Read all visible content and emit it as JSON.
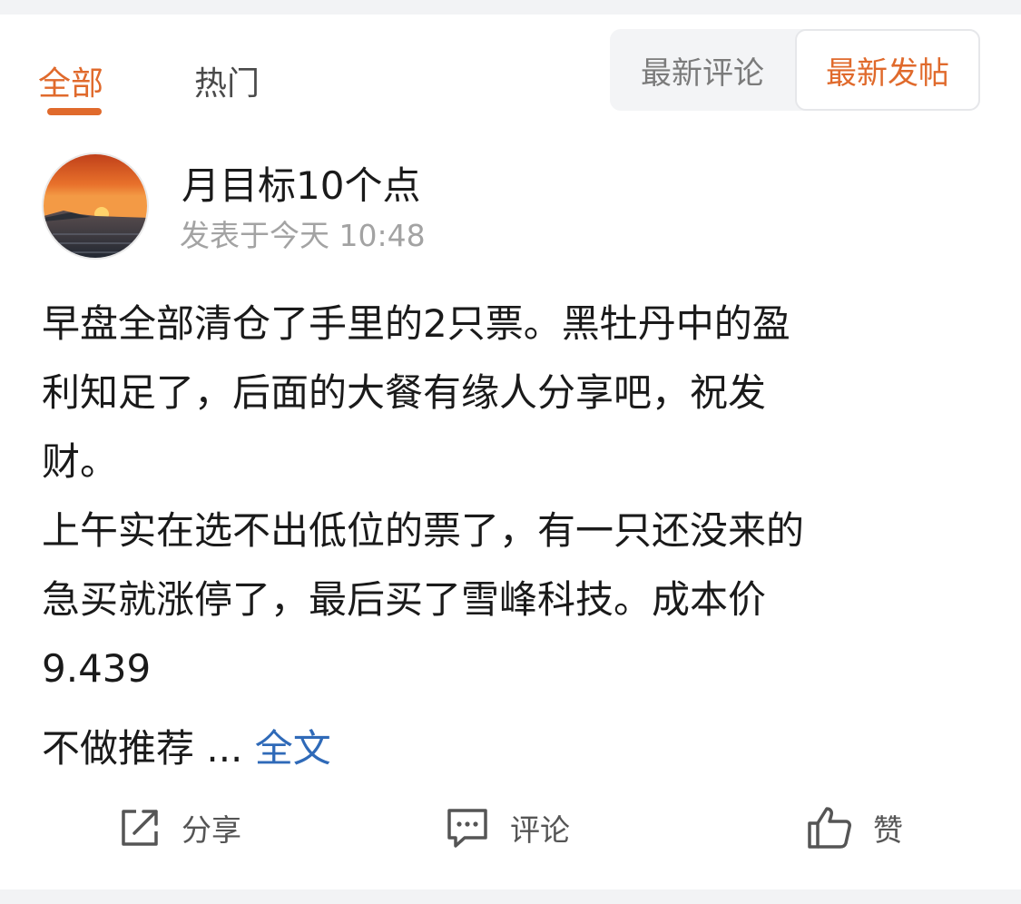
{
  "tabs": {
    "all": "全部",
    "hot": "热门"
  },
  "sort": {
    "latest_comment": "最新评论",
    "latest_post": "最新发帖"
  },
  "post": {
    "author": "月目标10个点",
    "timestamp": "发表于今天 10:48",
    "body": "早盘全部清仓了手里的2只票。黑牡丹中的盈\n利知足了，后面的大餐有缘人分享吧，祝发\n财。\n上午实在选不出低位的票了，有一只还没来的\n急买就涨停了，最后买了雪峰科技。成本价\n9.439",
    "tail_text": "不做推荐 ... ",
    "read_more": "全文"
  },
  "actions": {
    "share": "分享",
    "comment": "评论",
    "like": "赞"
  },
  "icons": {
    "share": "share-icon",
    "comment": "comment-icon",
    "like": "thumbs-up-icon"
  },
  "colors": {
    "accent": "#e06a2c",
    "link": "#2f6ab8",
    "muted": "#a3a3a3"
  }
}
